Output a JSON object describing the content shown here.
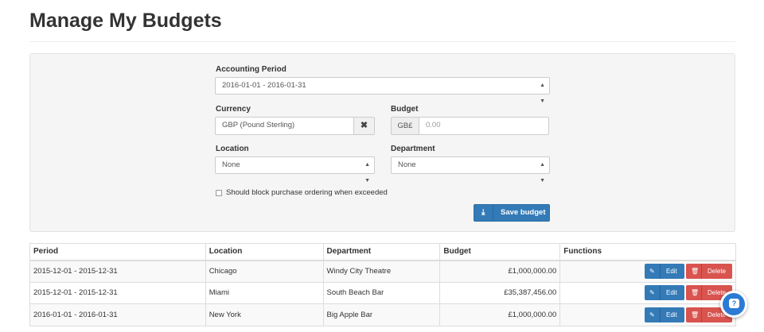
{
  "page": {
    "title": "Manage My Budgets"
  },
  "form": {
    "accounting_period": {
      "label": "Accounting Period",
      "value": "2016-01-01 - 2016-01-31"
    },
    "currency": {
      "label": "Currency",
      "value": "GBP (Pound Sterling)",
      "clear_icon": "times-icon",
      "clear_glyph": "✖"
    },
    "budget": {
      "label": "Budget",
      "prefix": "GB£",
      "placeholder": "0.00"
    },
    "location": {
      "label": "Location",
      "value": "None"
    },
    "department": {
      "label": "Department",
      "value": "None"
    },
    "block_ordering": {
      "label": "Should block purchase ordering when exceeded",
      "checked": false
    },
    "save": {
      "label": "Save budget",
      "icon": "download-icon",
      "glyph": "⤓"
    }
  },
  "table": {
    "headers": {
      "period": "Period",
      "location": "Location",
      "department": "Department",
      "budget": "Budget",
      "functions": "Functions"
    },
    "edit_label": "Edit",
    "delete_label": "Delete",
    "edit_glyph": "✎",
    "delete_glyph": "🗑",
    "rows": [
      {
        "period": "2015-12-01 - 2015-12-31",
        "location": "Chicago",
        "department": "Windy City Theatre",
        "budget": "£1,000,000.00"
      },
      {
        "period": "2015-12-01 - 2015-12-31",
        "location": "Miami",
        "department": "South Beach Bar",
        "budget": "£35,387,456.00"
      },
      {
        "period": "2016-01-01 - 2016-01-31",
        "location": "New York",
        "department": "Big Apple Bar",
        "budget": "£1,000,000.00"
      }
    ]
  },
  "help": {
    "icon": "help-chat-icon",
    "glyph": "?"
  },
  "colors": {
    "primary": "#337ab7",
    "danger": "#d9534f",
    "help": "#2b7bd4"
  }
}
